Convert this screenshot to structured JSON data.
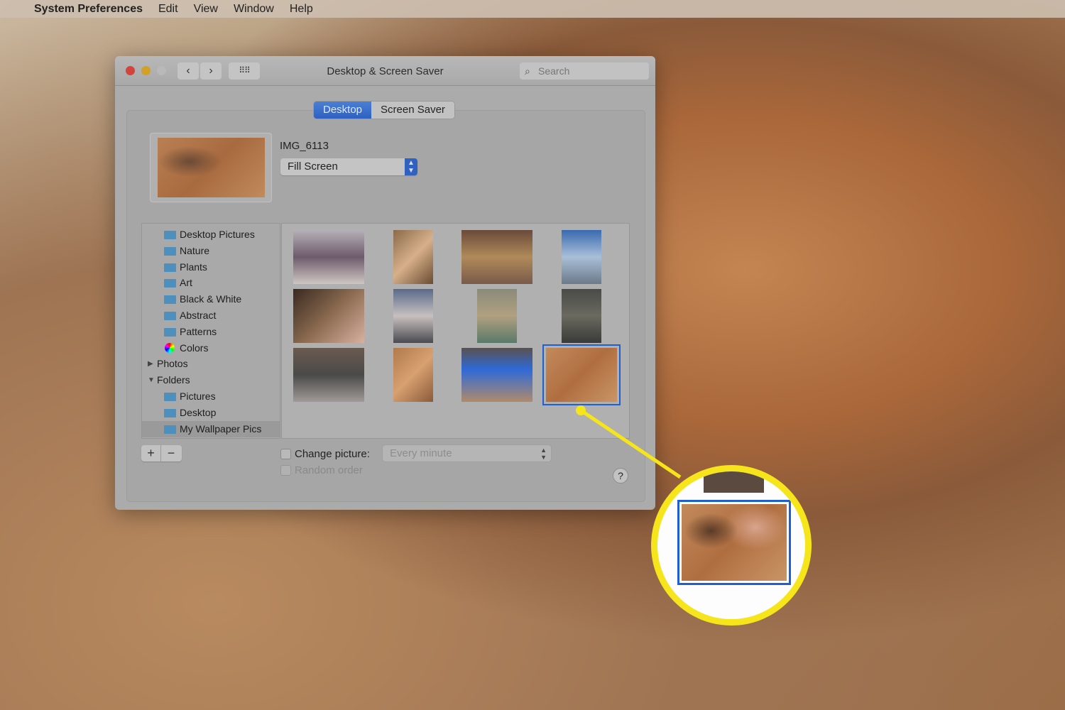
{
  "menubar": {
    "apple_icon": "apple-logo",
    "app": "System Preferences",
    "items": [
      "Edit",
      "View",
      "Window",
      "Help"
    ]
  },
  "window": {
    "title": "Desktop & Screen Saver",
    "search_placeholder": "Search",
    "back_icon": "chevron-left",
    "forward_icon": "chevron-right",
    "grid_icon": "grid-icon"
  },
  "tabs": [
    "Desktop",
    "Screen Saver"
  ],
  "active_tab": "Desktop",
  "current": {
    "name": "IMG_6113",
    "fit_mode": "Fill Screen"
  },
  "sidebar": {
    "items": [
      {
        "label": "Desktop Pictures",
        "icon": "folder"
      },
      {
        "label": "Nature",
        "icon": "folder"
      },
      {
        "label": "Plants",
        "icon": "folder"
      },
      {
        "label": "Art",
        "icon": "folder"
      },
      {
        "label": "Black & White",
        "icon": "folder"
      },
      {
        "label": "Abstract",
        "icon": "folder"
      },
      {
        "label": "Patterns",
        "icon": "folder"
      },
      {
        "label": "Colors",
        "icon": "color-wheel"
      },
      {
        "label": "Photos",
        "icon": "triangle-right"
      },
      {
        "label": "Folders",
        "icon": "triangle-down"
      },
      {
        "label": "Pictures",
        "icon": "pictures-folder"
      },
      {
        "label": "Desktop",
        "icon": "folder"
      },
      {
        "label": "My Wallpaper Pics",
        "icon": "folder",
        "selected": true
      }
    ]
  },
  "grid": {
    "selected_index": 11,
    "thumbnails": [
      "dog on carpet",
      "long-haired cat on floor",
      "cluttered room",
      "monument with dog",
      "cat close-up",
      "cat on stairs",
      "tabby cat on rug",
      "gray cat face",
      "gray cat on bed",
      "orange kitten",
      "cat with tablet",
      "orange cat paw (IMG_6113)"
    ]
  },
  "bottom": {
    "add": "+",
    "remove": "−",
    "change_picture": "Change picture:",
    "change_picture_checked": false,
    "interval": "Every minute",
    "random_order": "Random order",
    "random_checked": false,
    "help": "?"
  },
  "colors": {
    "accent": "#2e61c0",
    "callout": "#f5e51a",
    "selection": "#1f5fd0"
  }
}
